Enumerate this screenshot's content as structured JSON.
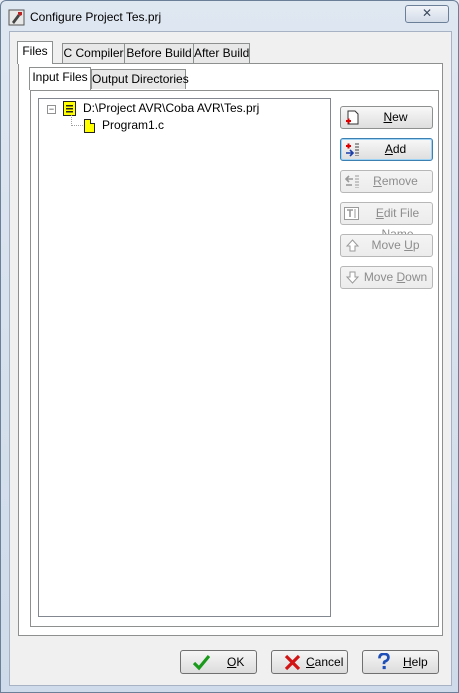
{
  "window": {
    "title": "Configure Project Tes.prj",
    "close_glyph": "✕"
  },
  "tabs": [
    {
      "label": "Files",
      "active": true
    },
    {
      "label": "C Compiler",
      "active": false
    },
    {
      "label": "Before Build",
      "active": false
    },
    {
      "label": "After Build",
      "active": false
    }
  ],
  "subtabs": [
    {
      "label": "Input Files",
      "active": true
    },
    {
      "label": "Output Directories",
      "active": false
    }
  ],
  "tree": {
    "root": {
      "label": "D:\\Project AVR\\Coba AVR\\Tes.prj",
      "expander": "−",
      "icon": "project-file-icon"
    },
    "children": [
      {
        "label": "Program1.c",
        "icon": "c-file-icon"
      }
    ]
  },
  "side_buttons": {
    "new": {
      "label": "New",
      "mnemonic": "N",
      "rest": "ew",
      "enabled": true,
      "icon": "new-file-icon"
    },
    "add": {
      "label": "Add",
      "mnemonic": "A",
      "rest": "dd",
      "enabled": true,
      "icon": "add-icon"
    },
    "remove": {
      "label": "Remove",
      "mnemonic": "R",
      "rest": "emove",
      "enabled": false,
      "icon": "remove-icon"
    },
    "edit": {
      "label": "Edit File Name",
      "mnemonic": "E",
      "rest": "dit File Name",
      "enabled": false,
      "icon": "edit-name-icon"
    },
    "up": {
      "label": "Move Up",
      "pre": "Move ",
      "mnemonic": "U",
      "rest": "p",
      "enabled": false,
      "icon": "arrow-up-icon"
    },
    "down": {
      "label": "Move Down",
      "pre": "Move ",
      "mnemonic": "D",
      "rest": "own",
      "enabled": false,
      "icon": "arrow-down-icon"
    }
  },
  "bottom_buttons": {
    "ok": {
      "label": "OK",
      "mnemonic": "O",
      "rest": "K",
      "icon": "checkmark-icon",
      "color": "#1a9a1a"
    },
    "cancel": {
      "label": "Cancel",
      "mnemonic": "C",
      "rest": "ancel",
      "icon": "x-icon",
      "color": "#d21414"
    },
    "help": {
      "label": "Help",
      "mnemonic": "H",
      "rest": "elp",
      "icon": "question-icon",
      "color": "#1e4fb8"
    }
  }
}
